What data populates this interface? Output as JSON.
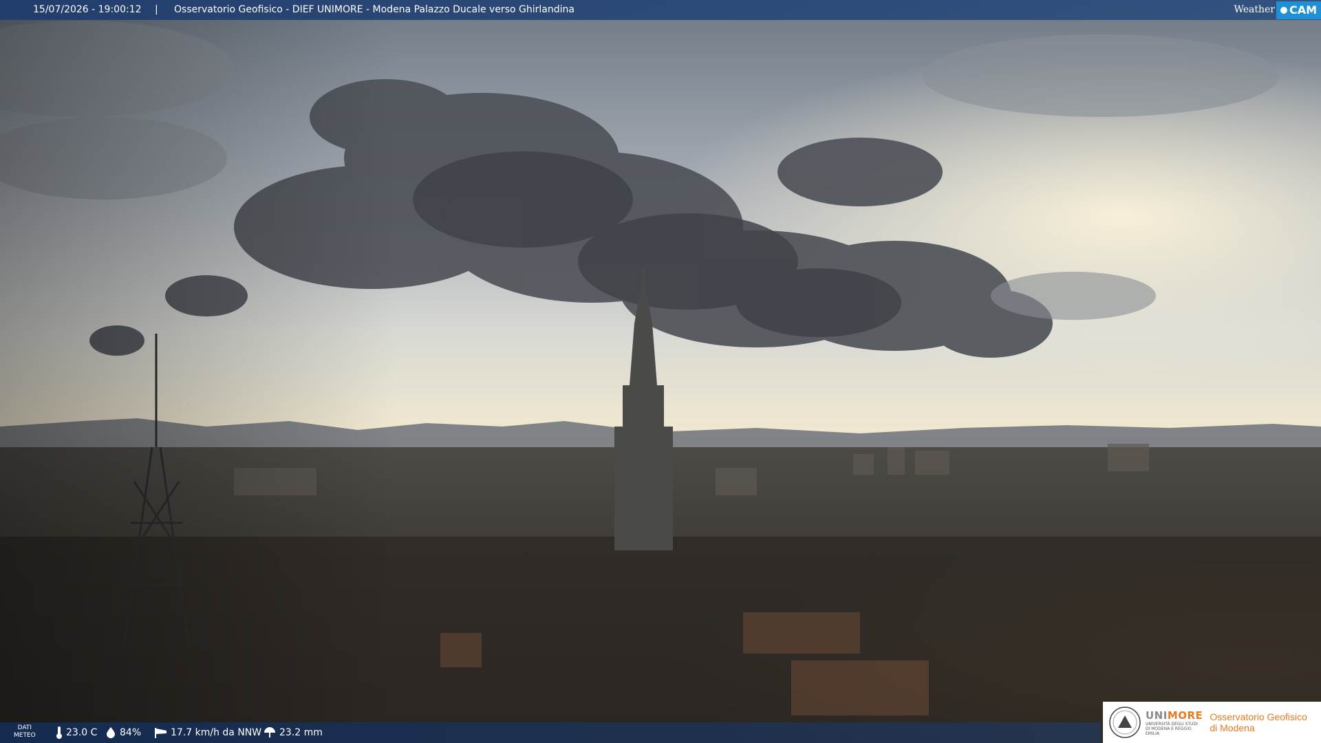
{
  "header": {
    "timestamp": "15/07/2026 - 19:00:12",
    "separator": "|",
    "title": "Osservatorio Geofisico - DIEF UNIMORE - Modena Palazzo Ducale verso Ghirlandina",
    "brand_left": "Weather",
    "brand_right": "CAM"
  },
  "weather": {
    "label_line1": "DATI",
    "label_line2": "METEO",
    "temperature": "23.0 C",
    "humidity": "84%",
    "wind": "17.7 km/h da NNW",
    "rain": "23.2 mm",
    "icons": [
      "thermometer-icon",
      "humidity-drop-icon",
      "wind-windsock-icon",
      "rain-umbrella-icon"
    ]
  },
  "logo": {
    "uni_prefix": "UNI",
    "uni_suffix": "MORE",
    "uni_sub": "UNIVERSITÀ DEGLI STUDI DI MODENA E REGGIO EMILIA",
    "obs_line1": "Osservatorio Geofisico",
    "obs_line2": "di Modena"
  },
  "colors": {
    "bar": "#1e3c6e",
    "accent": "#1f8fd6",
    "uni_orange": "#e67a1e"
  }
}
